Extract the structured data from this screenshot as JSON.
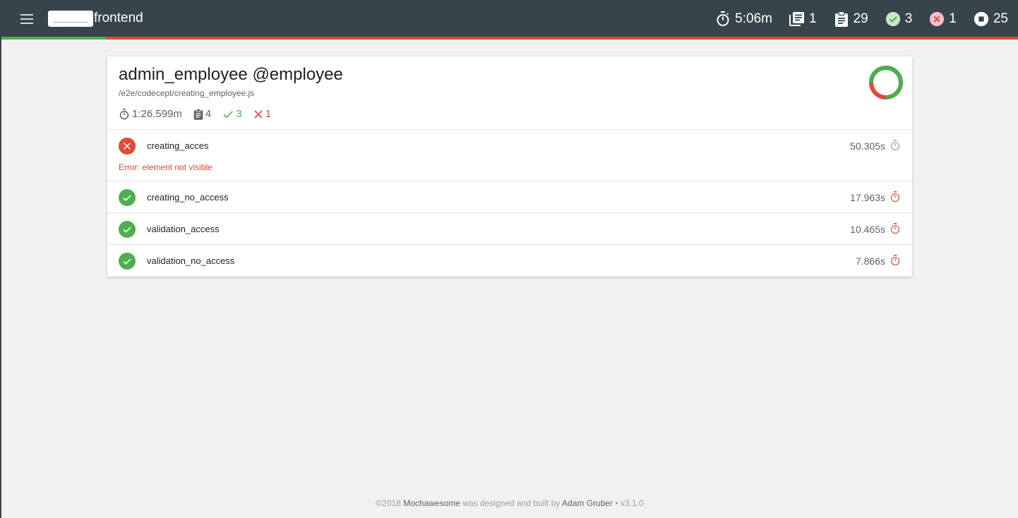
{
  "nav": {
    "brand": "frontend",
    "stats": {
      "duration": "5:06m",
      "suites": "1",
      "tests": "29",
      "passes": "3",
      "failures": "1",
      "pending": "25"
    },
    "pass_fraction": 0.103
  },
  "suite": {
    "title": "admin_employee @employee",
    "file": "/e2e/codecept/creating_employee.js",
    "duration": "1:26.599m",
    "tests": "4",
    "passes": "3",
    "failures": "1",
    "chart_pass_fraction": 0.75
  },
  "tests": [
    {
      "title": "creating_acces",
      "duration": "50.305s",
      "state": "failed",
      "error": "Error: element not visible"
    },
    {
      "title": "creating_no_access",
      "duration": "17.963s",
      "state": "passed"
    },
    {
      "title": "validation_access",
      "duration": "10.465s",
      "state": "passed"
    },
    {
      "title": "validation_no_access",
      "duration": "7.866s",
      "state": "passed"
    }
  ],
  "footer": {
    "copy": "©2018",
    "product": "Mochawesome",
    "middle": "was designed and built by",
    "author": "Adam Gruber",
    "version": "• v3.1.0"
  },
  "colors": {
    "nav_bg": "#37444c",
    "pass": "#4caf50",
    "fail": "#dd4b39",
    "page_bg": "#f1f1f1"
  }
}
